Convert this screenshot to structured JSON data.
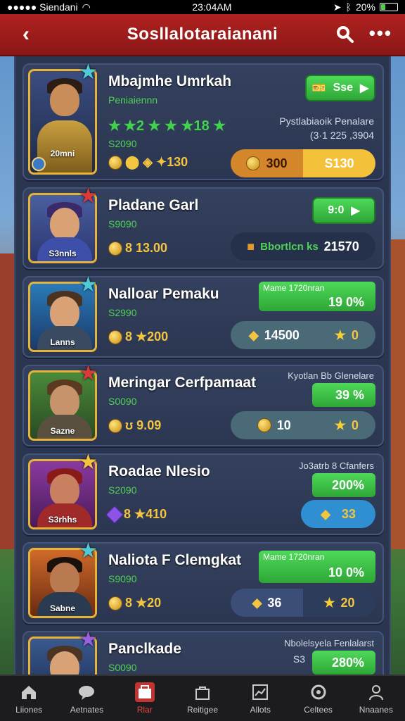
{
  "status_bar": {
    "carrier": "●●●●● Siendani",
    "time": "23:04AM",
    "battery": "20%"
  },
  "header": {
    "title": "Sosllalotaraianani"
  },
  "heroes": [
    {
      "name": "Mbajmhe Umrkah",
      "subtitle": "Peniaiennn",
      "portrait_tag": "20mni",
      "stat_line1": "★2 ★ ★ ★18 ★",
      "stat_line2": "S2090",
      "coins": "⬤ ◈ ✦130",
      "right_label_1": "Pystlabiaoik Penalare",
      "right_label_2": "(3·1 225 ,3904",
      "button": "Sse",
      "pill_left": "300",
      "pill_right": "S130",
      "star_color": "#4ec9d8"
    },
    {
      "name": "Pladane Garl",
      "subtitle": "S9090",
      "portrait_tag": "S3nnls",
      "coins": "8 13.00",
      "button": "9:0",
      "pill_text": "Bbortlcn ks",
      "pill_value": "21570",
      "star_color": "#d93b3b"
    },
    {
      "name": "Nalloar Pemaku",
      "subtitle": "S2990",
      "portrait_tag": "Lanns",
      "coins": "8 ★200",
      "right_label_1": "Mame 1720nran",
      "bar_value": "19 0%",
      "pill_left": "14500",
      "pill_right": "0",
      "star_color": "#4ec9d8"
    },
    {
      "name": "Meringar Cerfpamaat",
      "subtitle": "S0090",
      "portrait_tag": "Sazne",
      "coins": "ʊ 9.09",
      "right_label_1": "Kyotlan Bb Glenelare",
      "bar_value": "39 %",
      "pill_left": "10",
      "pill_right": "0",
      "star_color": "#d93b3b"
    },
    {
      "name": "Roadae Nlesio",
      "subtitle": "S2090",
      "portrait_tag": "S3rhhs",
      "coins": "8 ★410",
      "right_label_1": "Jo3atrb 8 Cfanfers",
      "bar_value": "200%",
      "pill_value": "33",
      "star_color": "#f3c440"
    },
    {
      "name": "Naliota F Clemgkat",
      "subtitle": "S9090",
      "portrait_tag": "Sabne",
      "coins": "8 ★20",
      "right_label_1": "Mame 1720nran",
      "bar_value": "10 0%",
      "pill_left": "36",
      "pill_right": "20",
      "star_color": "#4ec9d8"
    },
    {
      "name": "Panclkade",
      "subtitle": "S0090",
      "right_label_1": "Nbolelsyela Fenlalarst",
      "right_label_2": "S3",
      "bar_value": "280%",
      "star_color": "#9b5fe0"
    }
  ],
  "tabs": [
    {
      "label": "Liiones",
      "icon": "home-icon"
    },
    {
      "label": "Aetnates",
      "icon": "chat-icon"
    },
    {
      "label": "Rlar",
      "icon": "store-icon",
      "active": true
    },
    {
      "label": "Reitigee",
      "icon": "bag-icon"
    },
    {
      "label": "Allots",
      "icon": "chart-icon"
    },
    {
      "label": "Celtees",
      "icon": "settings-icon"
    },
    {
      "label": "Nnaanes",
      "icon": "profile-icon"
    }
  ]
}
